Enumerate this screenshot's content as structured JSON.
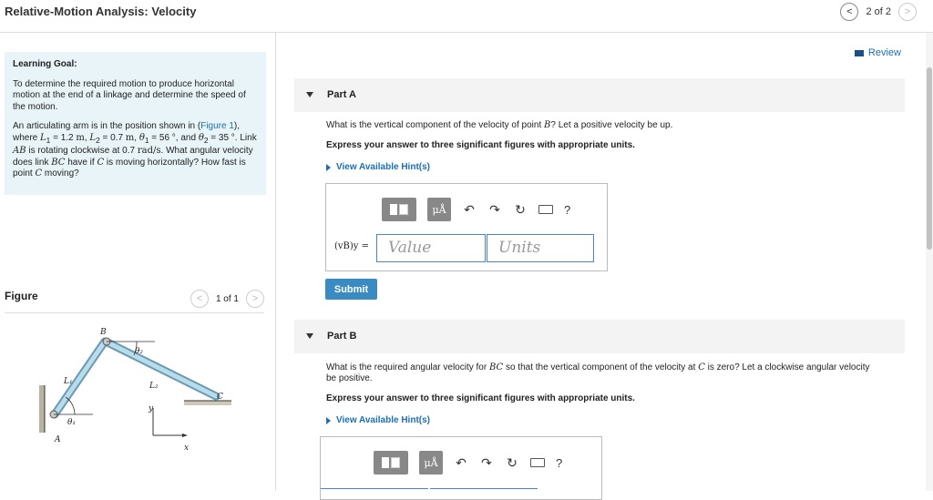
{
  "header": {
    "title": "Relative-Motion Analysis: Velocity",
    "page_indicator": "2 of 2",
    "prev_icon": "chevron-left",
    "next_icon": "chevron-right"
  },
  "goal": {
    "heading": "Learning Goal:",
    "text": "To determine the required motion to produce horizontal motion at the end of a linkage and determine the speed of the motion.",
    "p2_a": "An articulating arm is in the position shown in (",
    "figure_link": "Figure 1",
    "p2_b": "), where ",
    "L1": "L",
    "L1_sub": "1",
    "L1_val": " = 1.2 ",
    "L1_unit": "m",
    "L2": "L",
    "L2_sub": "2",
    "L2_val": " = 0.7 ",
    "L2_unit": "m",
    "th1": "θ",
    "th1_sub": "1",
    "th1_val": " = 56 °, and ",
    "th2": "θ",
    "th2_sub": "2",
    "th2_val": " = 35 °. Link ",
    "AB": "AB",
    "p2_c": " is rotating clockwise at 0.7 ",
    "rad_unit": "rad/s",
    "p2_d": ". What angular velocity does link ",
    "BC": "BC",
    "p2_e": " have if ",
    "C1": "C",
    "p2_f": " is moving horizontally? How fast is point ",
    "C2": "C",
    "p2_g": " moving?"
  },
  "figure": {
    "title": "Figure",
    "page_indicator": "1 of 1",
    "labels": {
      "B": "B",
      "theta2": "θ₂",
      "L1": "L₁",
      "L2": "L₂",
      "C": "C",
      "y": "y",
      "theta1": "θ₁",
      "A": "A",
      "x": "x"
    }
  },
  "review": {
    "label": "Review"
  },
  "partA": {
    "label": "Part A",
    "question_a": "What is the vertical component of the velocity of point ",
    "question_B": "B",
    "question_b": "? Let a positive velocity be up.",
    "instruction": "Express your answer to three significant figures with appropriate units.",
    "hint": "View Available Hint(s)",
    "var_label": "(vB)y =",
    "value_placeholder": "Value",
    "units_placeholder": "Units",
    "submit": "Submit",
    "mu_label": "μÅ",
    "help": "?"
  },
  "partB": {
    "label": "Part B",
    "question_a": "What is the required angular velocity for ",
    "question_BC": "BC",
    "question_b": " so that the vertical component of the velocity at ",
    "question_C": "C",
    "question_c": " is zero? Let a clockwise angular velocity be positive.",
    "instruction": "Express your answer to three significant figures with appropriate units.",
    "hint": "View Available Hint(s)",
    "mu_label": "μÅ",
    "help": "?"
  }
}
